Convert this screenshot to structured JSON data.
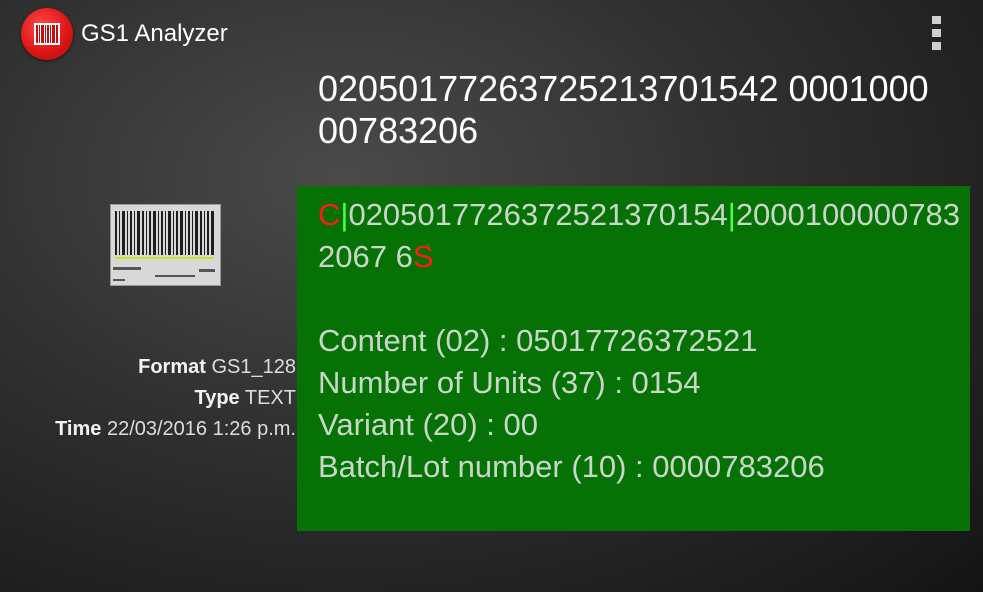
{
  "app_bar": {
    "title": "GS1 Analyzer",
    "app_icon": "barcode-icon",
    "menu_icon": "overflow-menu-icon"
  },
  "raw_code": "02050177263725213701542 0001000 00783206",
  "parsed": {
    "start_char": "C",
    "sep1": "|",
    "segment1": "02050177263725213701​54",
    "sep2": "|",
    "segment2": "20001000007832067 6",
    "end_char": "S"
  },
  "fields": [
    "Content (02) : 05017726372521",
    "Number of Units (37) : 0154",
    "Variant (20) : 00",
    "Batch/Lot number (10) : 0000783206"
  ],
  "meta": {
    "format_label": "Format",
    "format_value": "GS1_128",
    "type_label": "Type",
    "type_value": "TEXT",
    "time_label": "Time",
    "time_value": "22/03/2016 1:26 p.m."
  },
  "colors": {
    "panel_bg": "#067206",
    "control_char": "#ff1a1a",
    "separator": "#4dff4d",
    "icon_red": "#e01616"
  }
}
